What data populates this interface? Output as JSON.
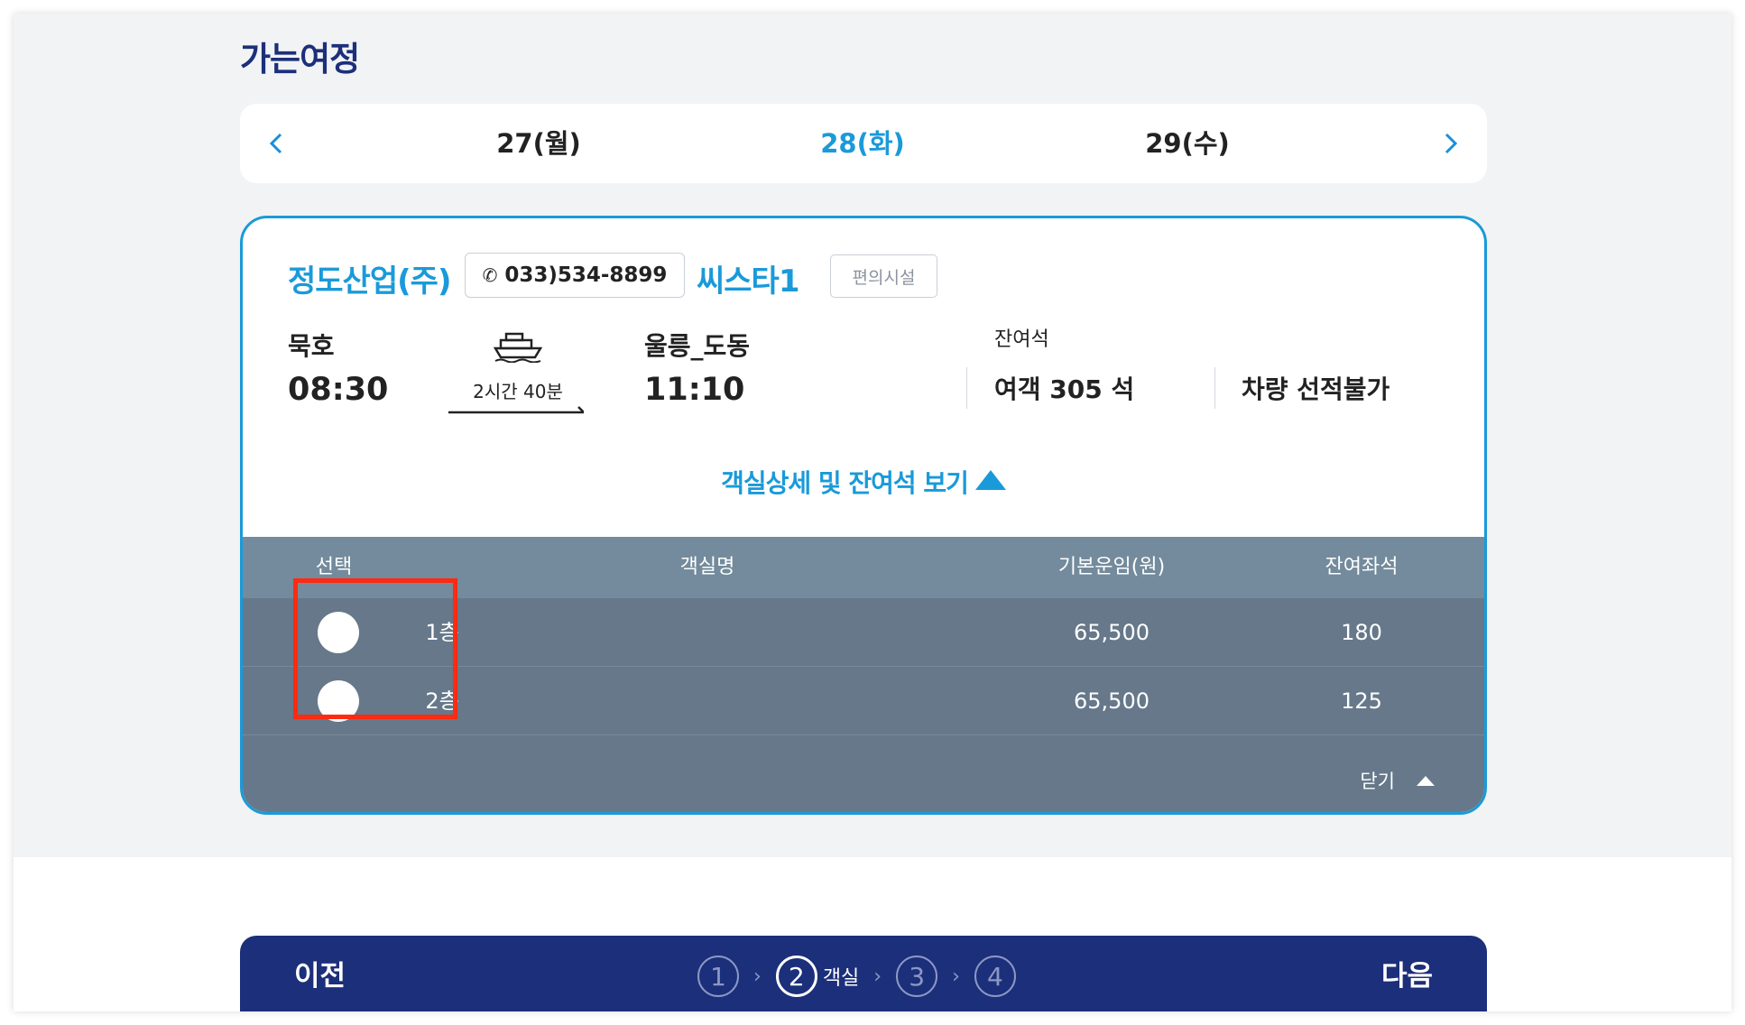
{
  "section_title": "가는여정",
  "dates": {
    "prev_icon": "chevron-left-icon",
    "next_icon": "chevron-right-icon",
    "items": [
      {
        "label": "27(월)",
        "active": false
      },
      {
        "label": "28(화)",
        "active": true
      },
      {
        "label": "29(수)",
        "active": false
      }
    ]
  },
  "trip": {
    "company": "정도산업(주)",
    "phone": "033)534-8899",
    "ship_name": "씨스타1",
    "facility_label": "편의시설",
    "departure_port": "묵호",
    "departure_time": "08:30",
    "duration": "2시간 40분",
    "arrival_port": "울릉_도동",
    "arrival_time": "11:10",
    "seats_label": "잔여석",
    "passenger_seats": "여객 305 석",
    "vehicle_seats": "차량 선적불가",
    "detail_link": "객실상세 및 잔여석 보기"
  },
  "table": {
    "headers": [
      "선택",
      "객실명",
      "기본운임(원)",
      "잔여좌석"
    ],
    "rows": [
      {
        "room": "1층",
        "fare": "65,500",
        "remaining": "180"
      },
      {
        "room": "2층",
        "fare": "65,500",
        "remaining": "125"
      }
    ],
    "close_label": "닫기"
  },
  "footer": {
    "prev_label": "이전",
    "next_label": "다음",
    "steps": [
      "1",
      "2",
      "3",
      "4"
    ],
    "active_step_label": "객실"
  },
  "colors": {
    "accent": "#1a9ad9",
    "navy": "#1c2f7a",
    "table_bg": "#66788a",
    "table_header": "#738b9c",
    "highlight": "#ff2a10"
  }
}
